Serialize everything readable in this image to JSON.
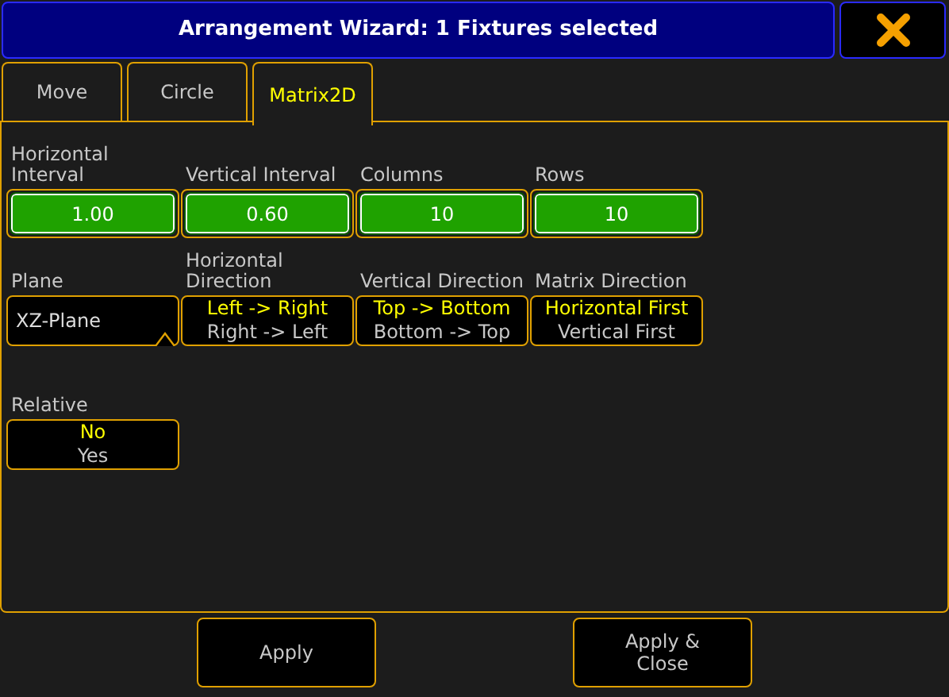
{
  "window": {
    "title": "Arrangement Wizard: 1 Fixtures selected"
  },
  "tabs": [
    {
      "label": "Move",
      "selected": false
    },
    {
      "label": "Circle",
      "selected": false
    },
    {
      "label": "Matrix2D",
      "selected": true
    }
  ],
  "numeric_fields": [
    {
      "label": "Horizontal Interval",
      "value": "1.00"
    },
    {
      "label": "Vertical Interval",
      "value": "0.60"
    },
    {
      "label": "Columns",
      "value": "10"
    },
    {
      "label": "Rows",
      "value": "10"
    }
  ],
  "selectors": [
    {
      "kind": "dropdown",
      "label": "Plane",
      "value": "XZ-Plane"
    },
    {
      "kind": "toggle",
      "label": "Horizontal Direction",
      "options": [
        {
          "text": "Left -> Right",
          "selected": true
        },
        {
          "text": "Right -> Left",
          "selected": false
        }
      ]
    },
    {
      "kind": "toggle",
      "label": "Vertical Direction",
      "options": [
        {
          "text": "Top -> Bottom",
          "selected": true
        },
        {
          "text": "Bottom -> Top",
          "selected": false
        }
      ]
    },
    {
      "kind": "toggle",
      "label": "Matrix Direction",
      "options": [
        {
          "text": "Horizontal First",
          "selected": true
        },
        {
          "text": "Vertical First",
          "selected": false
        }
      ]
    }
  ],
  "relative": {
    "label": "Relative",
    "options": [
      {
        "text": "No",
        "selected": true
      },
      {
        "text": "Yes",
        "selected": false
      }
    ]
  },
  "buttons": [
    "Apply",
    "Apply & Close"
  ]
}
